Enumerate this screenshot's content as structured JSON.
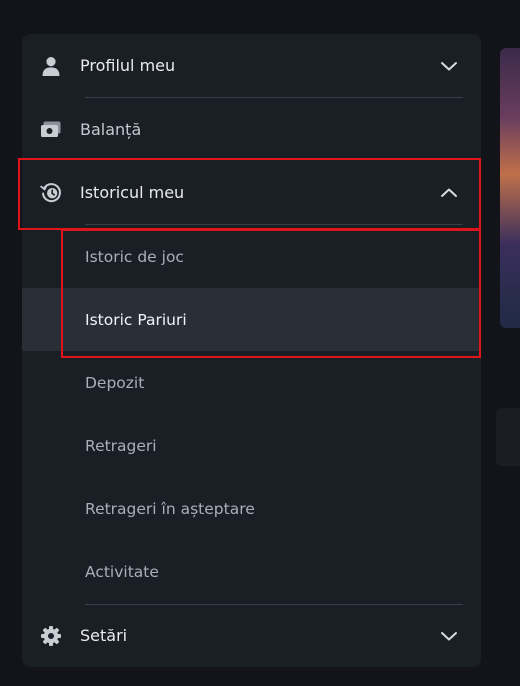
{
  "menu": {
    "profile": {
      "label": "Profilul meu",
      "icon": "user-icon",
      "expanded": false
    },
    "balance": {
      "label": "Balanță",
      "icon": "wallet-icon"
    },
    "history": {
      "label": "Istoricul meu",
      "icon": "history-icon",
      "expanded": true,
      "items": [
        {
          "label": "Istoric de joc",
          "active": false
        },
        {
          "label": "Istoric Pariuri",
          "active": true
        },
        {
          "label": "Depozit",
          "active": false
        },
        {
          "label": "Retrageri",
          "active": false
        },
        {
          "label": "Retrageri în așteptare",
          "active": false
        },
        {
          "label": "Activitate",
          "active": false
        }
      ]
    },
    "settings": {
      "label": "Setări",
      "icon": "gear-icon",
      "expanded": false
    }
  },
  "colors": {
    "panel": "#1a1e25",
    "active_row": "#2a2f37",
    "highlight": "#e0141b",
    "text": "#e9ebef",
    "sub_text": "#a9aeb8"
  }
}
